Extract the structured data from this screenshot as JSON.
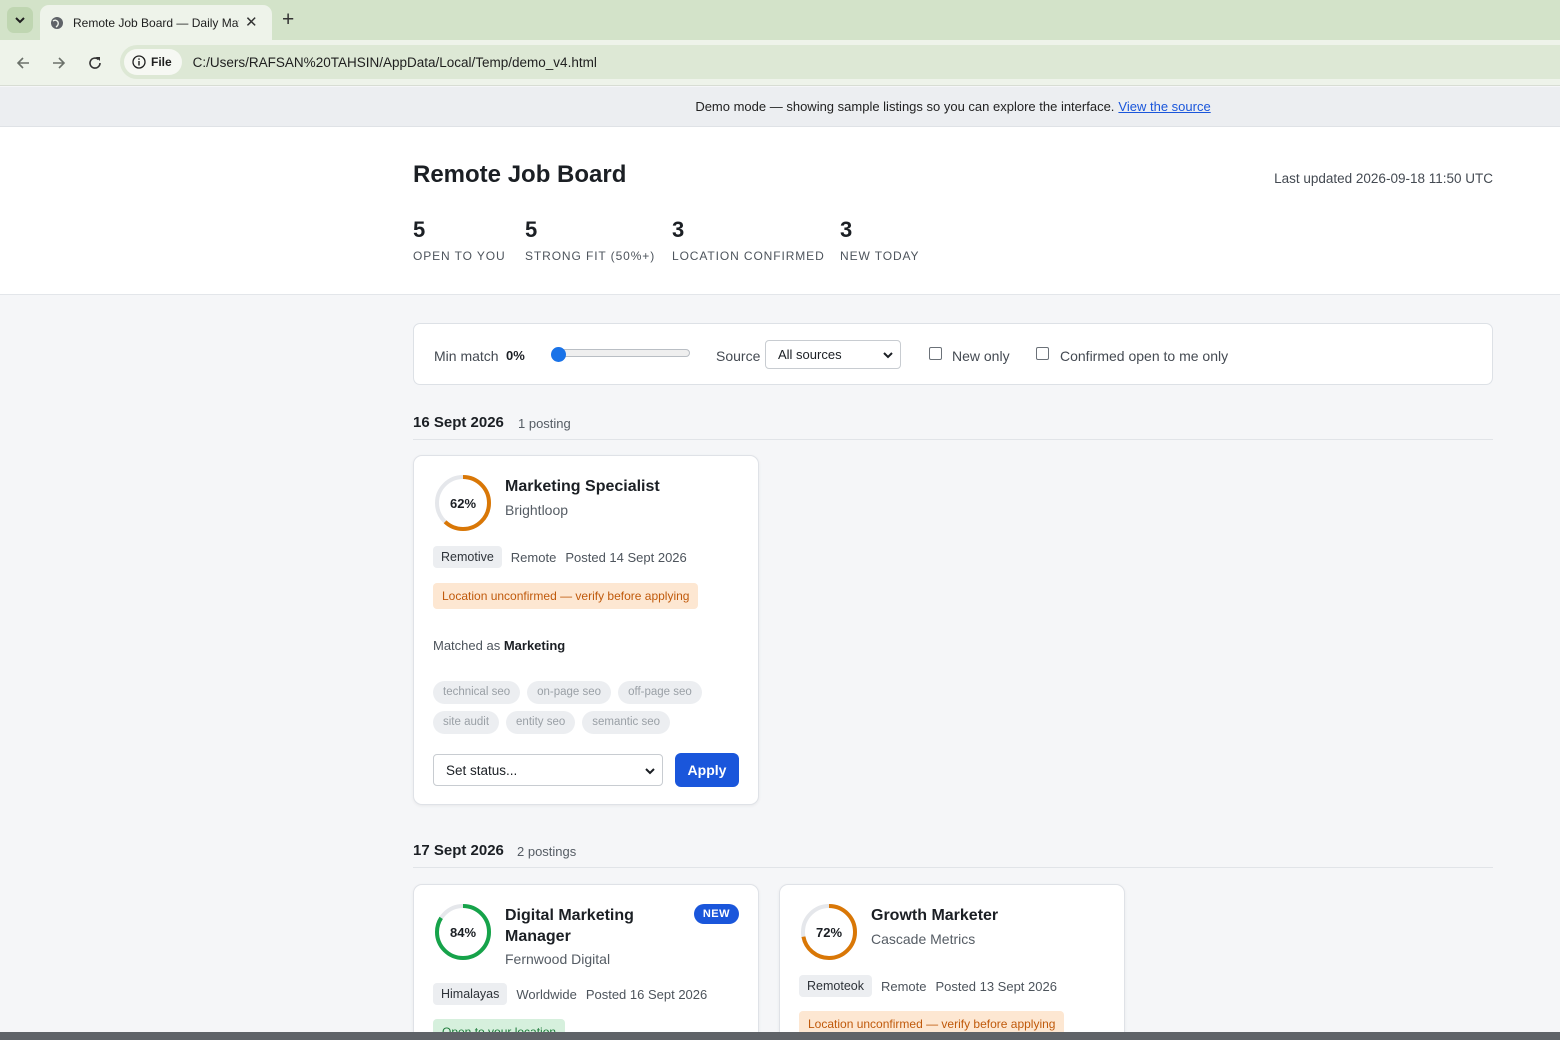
{
  "browser": {
    "tab_title": "Remote Job Board — Daily Mat",
    "url": "C:/Users/RAFSAN%20TAHSIN/AppData/Local/Temp/demo_v4.html",
    "chip_label": "File"
  },
  "banner": {
    "text": "Demo mode — showing sample listings so you can explore the interface.",
    "link": "View the source"
  },
  "header": {
    "title": "Remote Job Board",
    "last_updated": "Last updated 2026-09-18 11:50 UTC",
    "stats": [
      {
        "value": "5",
        "label": "Open to you"
      },
      {
        "value": "5",
        "label": "Strong fit (50%+)"
      },
      {
        "value": "3",
        "label": "Location confirmed"
      },
      {
        "value": "3",
        "label": "New today"
      }
    ]
  },
  "filters": {
    "min_match_label": "Min match",
    "min_match_value": "0%",
    "source_label": "Source",
    "source_value": "All sources",
    "new_only_label": "New only",
    "confirmed_label": "Confirmed open to me only"
  },
  "sections": [
    {
      "date": "16 Sept 2026",
      "count": "1 posting",
      "cards": [
        {
          "match": "62%",
          "match_value": 62,
          "ring_color": "#d97706",
          "title": "Marketing Specialist",
          "company": "Brightloop",
          "source": "Remotive",
          "location": "Remote",
          "posted": "Posted 14 Sept 2026",
          "location_note": "Location unconfirmed — verify before applying",
          "matched_prefix": "Matched as",
          "matched_as": "Marketing",
          "tags": [
            "technical seo",
            "on-page seo",
            "off-page seo",
            "site audit",
            "entity seo",
            "semantic seo"
          ],
          "status_placeholder": "Set status...",
          "apply_label": "Apply"
        }
      ]
    },
    {
      "date": "17 Sept 2026",
      "count": "2 postings",
      "cards": [
        {
          "match": "84%",
          "match_value": 84,
          "ring_color": "#16a34a",
          "title_line1": "Digital Marketing",
          "title_line2": "Manager",
          "company": "Fernwood Digital",
          "badge": "NEW",
          "source": "Himalayas",
          "location": "Worldwide",
          "posted": "Posted 16 Sept 2026",
          "location_note": "Open to your location"
        },
        {
          "match": "72%",
          "match_value": 72,
          "ring_color": "#d97706",
          "title": "Growth Marketer",
          "company": "Cascade Metrics",
          "source": "Remoteok",
          "location": "Remote",
          "posted": "Posted 13 Sept 2026",
          "location_note": "Location unconfirmed — verify before applying"
        }
      ]
    }
  ]
}
